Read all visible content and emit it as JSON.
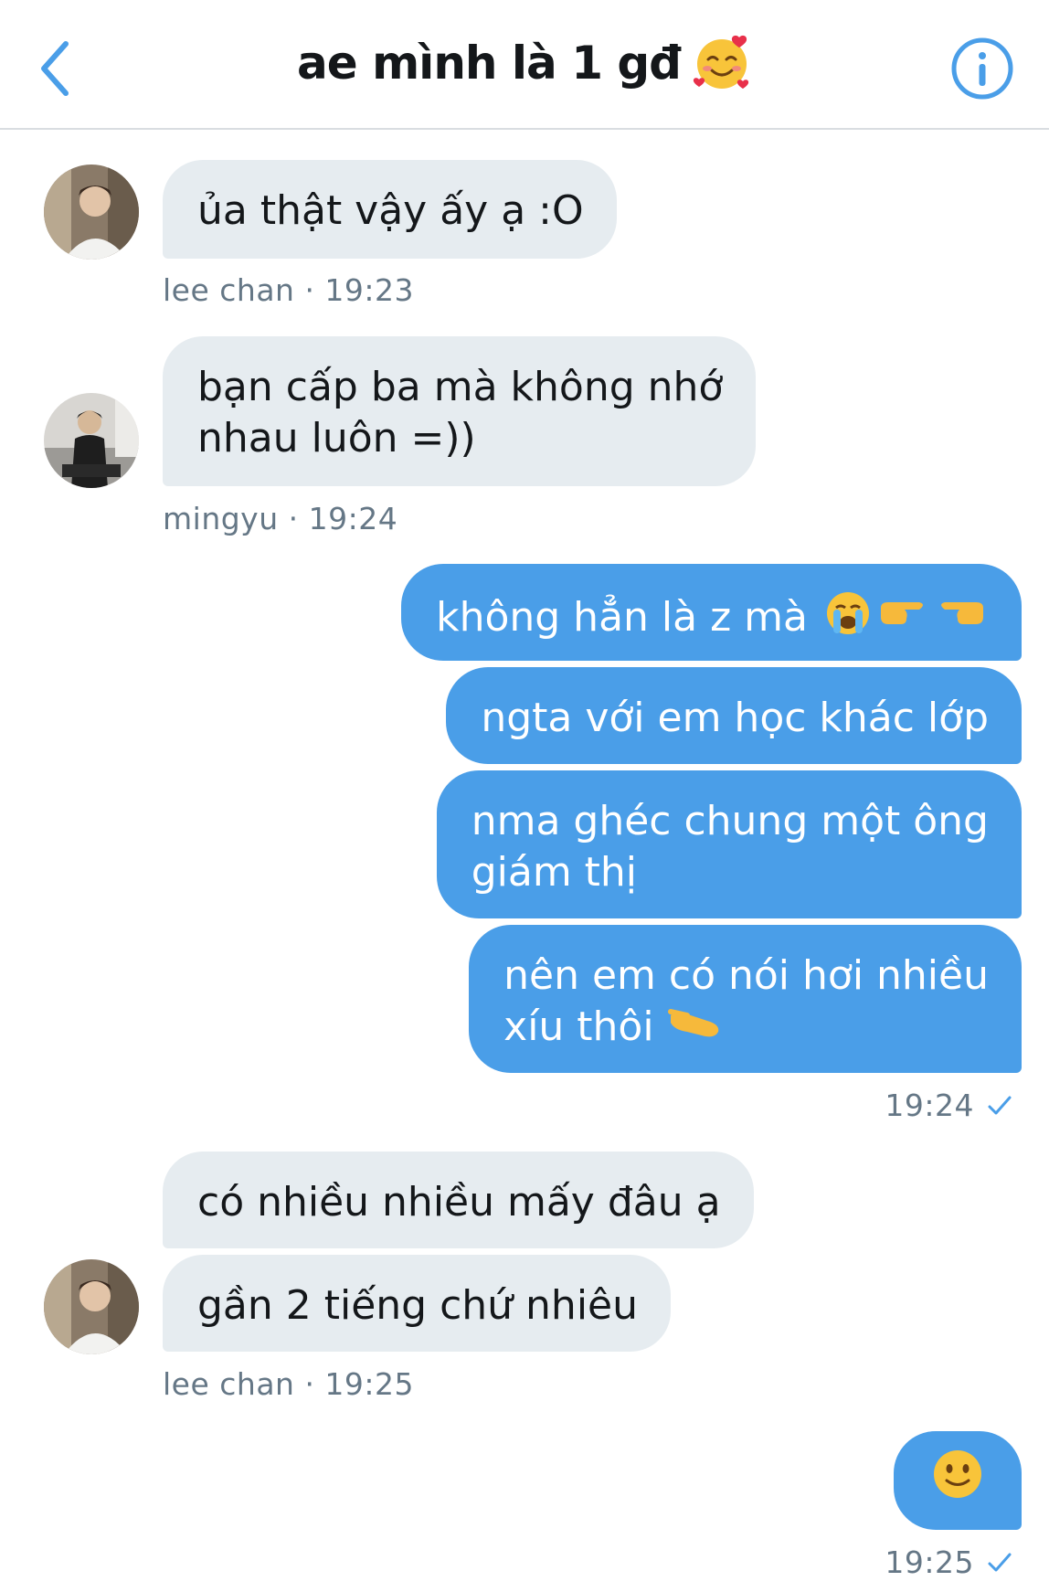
{
  "header": {
    "title": "ae mình là 1 gđ",
    "title_emoji": "smiling-face-with-hearts-icon"
  },
  "colors": {
    "accent": "#4a9ee8",
    "incoming_bubble": "#e6ecf0",
    "meta_text": "#657786"
  },
  "messages": [
    {
      "direction": "incoming",
      "lines": [
        "ủa thật vậy ấy ạ :O"
      ]
    },
    {
      "direction": "incoming",
      "lines": [
        "bạn cấp ba mà không nhớ",
        "nhau luôn =))"
      ]
    },
    {
      "direction": "outgoing",
      "lines": [
        "không hẳn là z mà"
      ],
      "emojis": [
        "crying-face-icon",
        "pointing-right-icon",
        "pointing-left-icon"
      ]
    },
    {
      "direction": "outgoing",
      "lines": [
        "ngta với em học khác lớp"
      ]
    },
    {
      "direction": "outgoing",
      "lines": [
        "nma ghéc chung một ông",
        "giám thị"
      ]
    },
    {
      "direction": "outgoing",
      "lines": [
        "nên em có nói hơi nhiều",
        "xíu thôi"
      ],
      "emojis": [
        "pinching-hand-icon"
      ]
    },
    {
      "direction": "incoming",
      "lines": [
        "có nhiều nhiều mấy đâu ạ"
      ]
    },
    {
      "direction": "incoming",
      "lines": [
        "gần 2 tiếng chứ nhiêu"
      ]
    },
    {
      "direction": "outgoing",
      "lines": [],
      "emojis": [
        "slightly-smiling-face-icon"
      ]
    }
  ],
  "meta": {
    "m1": "lee chan · 19:23",
    "m2": "mingyu · 19:24",
    "m3": "19:24",
    "m4": "lee chan · 19:25",
    "m5": "19:25"
  }
}
